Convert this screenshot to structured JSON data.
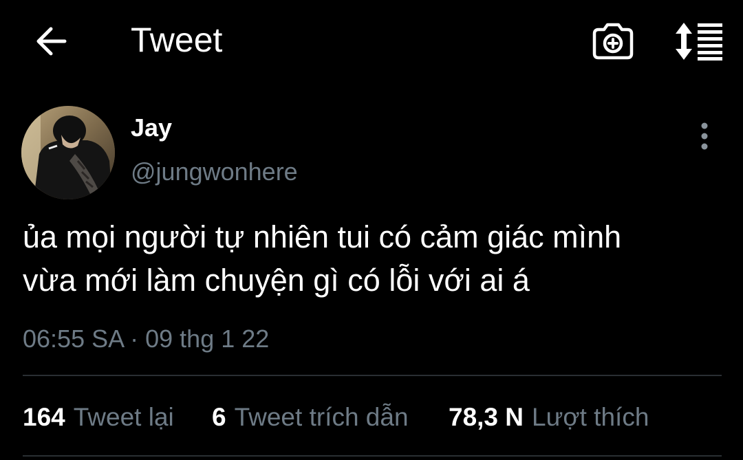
{
  "header": {
    "title": "Tweet",
    "back_icon": "arrow-left-icon",
    "camera_icon": "camera-plus-icon",
    "sort_icon": "sort-list-icon"
  },
  "tweet": {
    "author": {
      "name": "Jay",
      "handle": "@jungwonhere"
    },
    "text_lines": [
      "ủa mọi người tự nhiên tui có cảm giác mình",
      "vừa mới làm chuyện gì có lỗi với ai á"
    ],
    "timestamp": "06:55 SA · 09 thg 1 22",
    "stats": {
      "retweets": {
        "count": "164",
        "label": "Tweet lại"
      },
      "quotes": {
        "count": "6",
        "label": "Tweet trích dẫn"
      },
      "likes": {
        "count": "78,3 N",
        "label": "Lượt thích"
      }
    }
  },
  "colors": {
    "background": "#000000",
    "primary_text": "#ffffff",
    "secondary_text": "#6e7b86",
    "divider": "#2a2f33"
  }
}
